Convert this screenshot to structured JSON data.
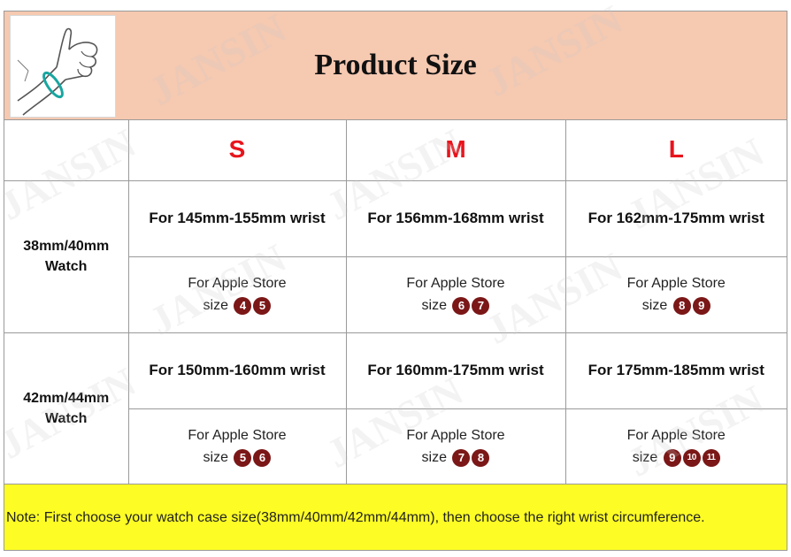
{
  "header": {
    "title": "Product Size",
    "illustration_icon": "wrist-measure-icon"
  },
  "sizes": [
    {
      "label": "S"
    },
    {
      "label": "M"
    },
    {
      "label": "L"
    }
  ],
  "groups": [
    {
      "model_line1": "38mm/40mm",
      "model_line2": "Watch",
      "wrist": [
        "For 145mm-155mm wrist",
        "For 156mm-168mm wrist",
        "For 162mm-175mm wrist"
      ],
      "store_label": "For Apple Store",
      "size_word": "size",
      "store_sizes": [
        [
          "4",
          "5"
        ],
        [
          "6",
          "7"
        ],
        [
          "8",
          "9"
        ]
      ]
    },
    {
      "model_line1": "42mm/44mm",
      "model_line2": "Watch",
      "wrist": [
        "For 150mm-160mm wrist",
        "For 160mm-175mm wrist",
        "For 175mm-185mm wrist"
      ],
      "store_label": "For Apple Store",
      "size_word": "size",
      "store_sizes": [
        [
          "5",
          "6"
        ],
        [
          "7",
          "8"
        ],
        [
          "9",
          "10",
          "11"
        ]
      ]
    }
  ],
  "note": "Note: First choose your watch case size(38mm/40mm/42mm/44mm), then choose the right wrist circumference.",
  "watermark": "JANSIN",
  "colors": {
    "header_bg": "#f6c9b1",
    "size_letter": "#e8141c",
    "badge": "#7b1717",
    "note_bg": "#fdfd25",
    "grid": "#9a9a9a"
  }
}
